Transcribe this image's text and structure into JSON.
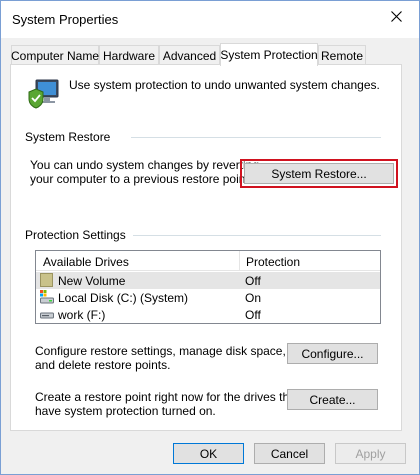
{
  "window": {
    "title": "System Properties"
  },
  "tabs": [
    {
      "label": "Computer Name"
    },
    {
      "label": "Hardware"
    },
    {
      "label": "Advanced"
    },
    {
      "label": "System Protection"
    },
    {
      "label": "Remote"
    }
  ],
  "intro": "Use system protection to undo unwanted system changes.",
  "restore": {
    "group": "System Restore",
    "desc1": "You can undo system changes by reverting",
    "desc2": "your computer to a previous restore point.",
    "button": "System Restore..."
  },
  "protection": {
    "group": "Protection Settings",
    "col_drives": "Available Drives",
    "col_protection": "Protection",
    "drives": [
      {
        "name": "New Volume",
        "status": "Off",
        "icon": "folder-drive-icon"
      },
      {
        "name": "Local Disk (C:) (System)",
        "status": "On",
        "icon": "system-drive-icon"
      },
      {
        "name": "work (F:)",
        "status": "Off",
        "icon": "hard-drive-icon"
      }
    ],
    "configure_desc1": "Configure restore settings, manage disk space,",
    "configure_desc2": "and delete restore points.",
    "configure_button": "Configure...",
    "create_desc1": "Create a restore point right now for the drives that",
    "create_desc2": "have system protection turned on.",
    "create_button": "Create..."
  },
  "footer": {
    "ok": "OK",
    "cancel": "Cancel",
    "apply": "Apply"
  }
}
